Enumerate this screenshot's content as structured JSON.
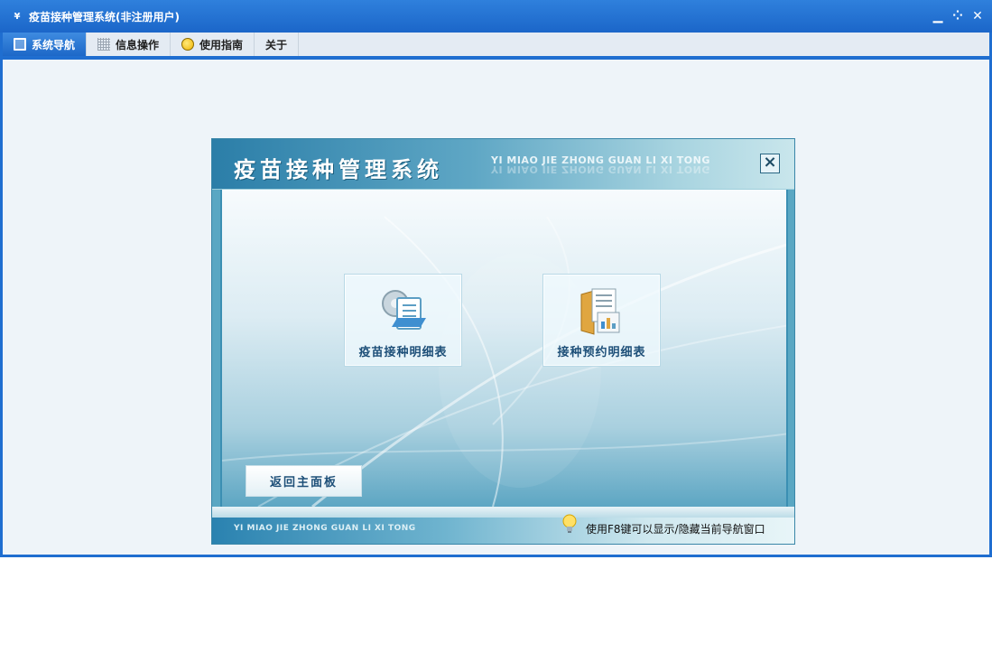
{
  "window": {
    "title": "疫苗接种管理系统(非注册用户)",
    "logo_text": "Y"
  },
  "menu": {
    "tabs": [
      {
        "label": "系统导航",
        "icon": "monitor-icon",
        "active": true
      },
      {
        "label": "信息操作",
        "icon": "grid-icon",
        "active": false
      },
      {
        "label": "使用指南",
        "icon": "help-icon",
        "active": false
      },
      {
        "label": "关于",
        "icon": "",
        "active": false
      }
    ]
  },
  "nav_panel": {
    "title": "疫苗接种管理系统",
    "pinyin": "YI MIAO JIE ZHONG GUAN LI XI TONG",
    "tiles": [
      {
        "label": "疫苗接种明细表",
        "icon": "document-gear-icon"
      },
      {
        "label": "接种预约明细表",
        "icon": "folder-document-icon"
      }
    ],
    "back_button": "返回主面板",
    "footer_pinyin": "YI MIAO JIE ZHONG GUAN LI XI TONG",
    "tip": "使用F8键可以显示/隐藏当前导航窗口"
  },
  "colors": {
    "title_bar": "#1f6ed0",
    "panel_accent": "#3b8fb3",
    "tile_text": "#1d4f78"
  }
}
